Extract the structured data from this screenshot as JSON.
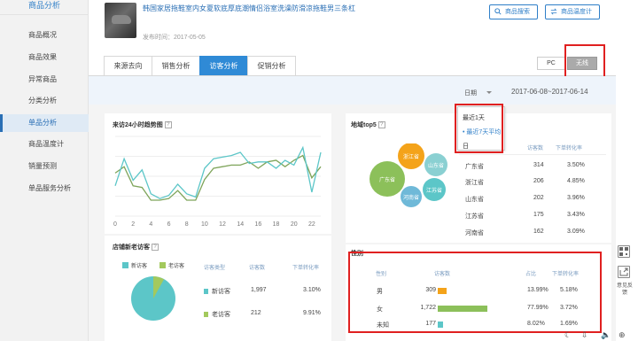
{
  "sidebar": {
    "title": "商品分析",
    "items": [
      {
        "label": "商品概况",
        "active": false
      },
      {
        "label": "商品效果",
        "active": false
      },
      {
        "label": "异常商品",
        "active": false
      },
      {
        "label": "分类分析",
        "active": false
      },
      {
        "label": "单品分析",
        "active": true
      },
      {
        "label": "商品温度计",
        "active": false
      },
      {
        "label": "销量预测",
        "active": false
      },
      {
        "label": "单品服务分析",
        "active": false
      }
    ]
  },
  "product": {
    "title": "韩国家居拖鞋室内女夏软底厚底潮情侣浴室洗澡防滑凉拖鞋男三条杠",
    "date": "发布时间：2017-05-05"
  },
  "header_buttons": {
    "search": "商品搜索",
    "thermo": "商品温度计"
  },
  "tabs": [
    "来源去向",
    "销售分析",
    "访客分析",
    "促销分析"
  ],
  "active_tab": "访客分析",
  "device": {
    "pc": "PC",
    "wireless": "无线",
    "selected": "无线"
  },
  "date": {
    "label": "日期",
    "range": "2017-06-08~2017-06-14",
    "options": [
      "最近1天",
      "最近7天平均",
      "日"
    ],
    "selected": "最近7天平均"
  },
  "trend": {
    "title": "来访24小时趋势图",
    "x_ticks": [
      "0",
      "2",
      "4",
      "6",
      "8",
      "10",
      "12",
      "14",
      "16",
      "18",
      "20",
      "22"
    ]
  },
  "region": {
    "title": "地域top5",
    "headers": [
      "访客数",
      "下单转化率"
    ],
    "rows": [
      {
        "name": "广东省",
        "visitors": "314",
        "rate": "3.50%"
      },
      {
        "name": "浙江省",
        "visitors": "206",
        "rate": "4.85%"
      },
      {
        "name": "山东省",
        "visitors": "202",
        "rate": "3.96%"
      },
      {
        "name": "江苏省",
        "visitors": "175",
        "rate": "3.43%"
      },
      {
        "name": "河南省",
        "visitors": "162",
        "rate": "3.09%"
      }
    ],
    "bubbles": [
      "浙江省",
      "山东省",
      "广东省",
      "江苏省",
      "河南省"
    ]
  },
  "newold": {
    "title": "店铺新老访客",
    "legend": [
      "新访客",
      "老访客"
    ],
    "headers": [
      "访客类型",
      "访客数",
      "下单转化率"
    ],
    "rows": [
      {
        "type": "新访客",
        "visitors": "1,997",
        "rate": "3.10%"
      },
      {
        "type": "老访客",
        "visitors": "212",
        "rate": "9.91%"
      }
    ],
    "colors": {
      "new": "#5cc6c8",
      "old": "#a3c95d"
    }
  },
  "gender": {
    "title": "性别",
    "headers": [
      "性别",
      "访客数",
      "占比",
      "下单转化率"
    ],
    "rows": [
      {
        "label": "男",
        "visitors": "309",
        "share": "13.99%",
        "rate": "5.18%",
        "color": "#f4a31a",
        "share_value": 0.1399
      },
      {
        "label": "女",
        "visitors": "1,722",
        "share": "77.99%",
        "rate": "3.72%",
        "color": "#8cc05a",
        "share_value": 0.7799
      },
      {
        "label": "未知",
        "visitors": "177",
        "share": "8.02%",
        "rate": "1.69%",
        "color": "#5cc6c8",
        "share_value": 0.0802
      }
    ]
  },
  "float_panel": {
    "feedback": "意见反馈"
  },
  "colors": {
    "accent": "#2f8ad6",
    "highlight": "#e02020",
    "line_teal": "#5cc6c8",
    "line_green": "#7ea45a"
  }
}
